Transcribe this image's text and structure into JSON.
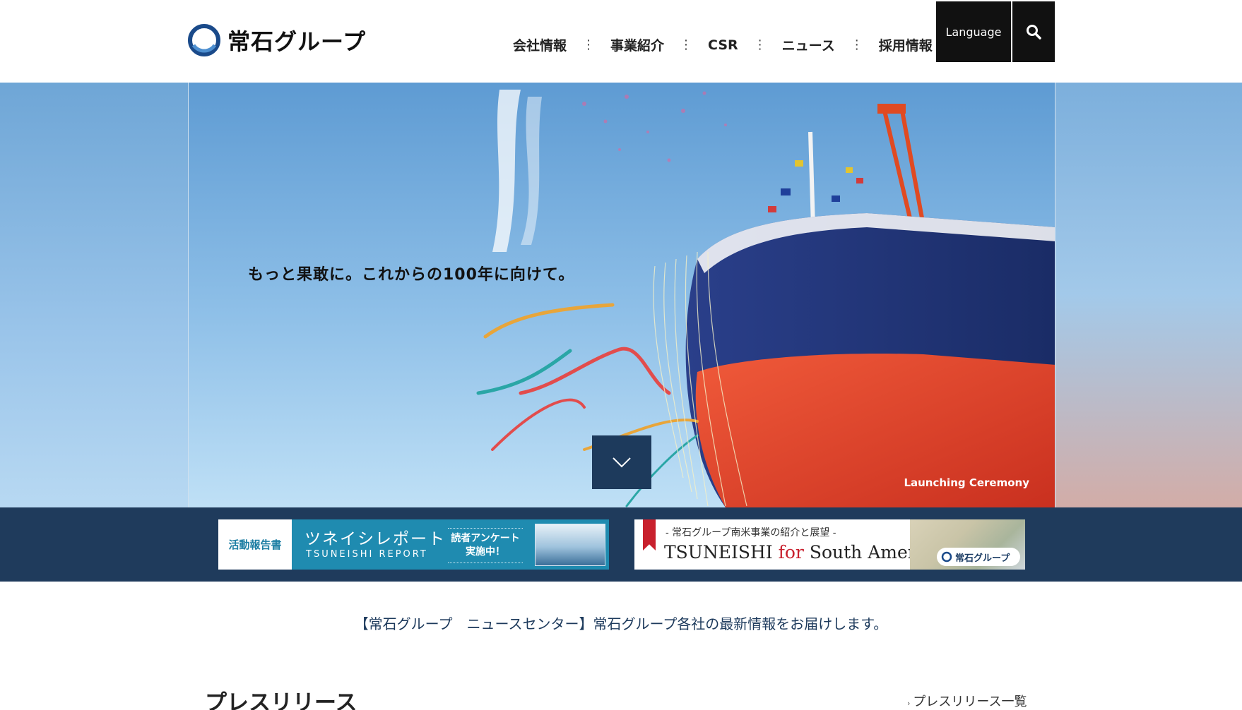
{
  "header": {
    "logo_text": "常石グループ",
    "nav": [
      {
        "label": "会社情報"
      },
      {
        "label": "事業紹介"
      },
      {
        "label": "CSR"
      },
      {
        "label": "ニュース"
      },
      {
        "label": "採用情報"
      }
    ],
    "nav_separator": "⋮",
    "language_label": "Language",
    "search_icon": "search-icon"
  },
  "hero": {
    "caption": "もっと果敢に。これからの100年に向けて。",
    "photo_tag": "Launching Ceremony",
    "scroll_icon": "chevron-down-icon"
  },
  "banners": {
    "report": {
      "badge": "活動報告書",
      "title": "ツネイシレポート",
      "subtitle": "TSUNEISHI REPORT",
      "cta_line1": "読者アンケート",
      "cta_line2": "実施中！"
    },
    "south_america": {
      "subtitle": "- 常石グループ南米事業の紹介と展望 -",
      "title_pre": "TSUNEISHI ",
      "title_for": "for",
      "title_post": " South America",
      "logo_text": "常石グループ"
    }
  },
  "tagline": "【常石グループ　ニュースセンター】常石グループ各社の最新情報をお届けします。",
  "press": {
    "title": "プレスリリース",
    "list_link": "プレスリリース一覧",
    "arrow": "›"
  },
  "colors": {
    "navy": "#1f3b5c",
    "header_black": "#111111",
    "report_teal": "#1f8bb0",
    "accent_red": "#c8202d"
  }
}
